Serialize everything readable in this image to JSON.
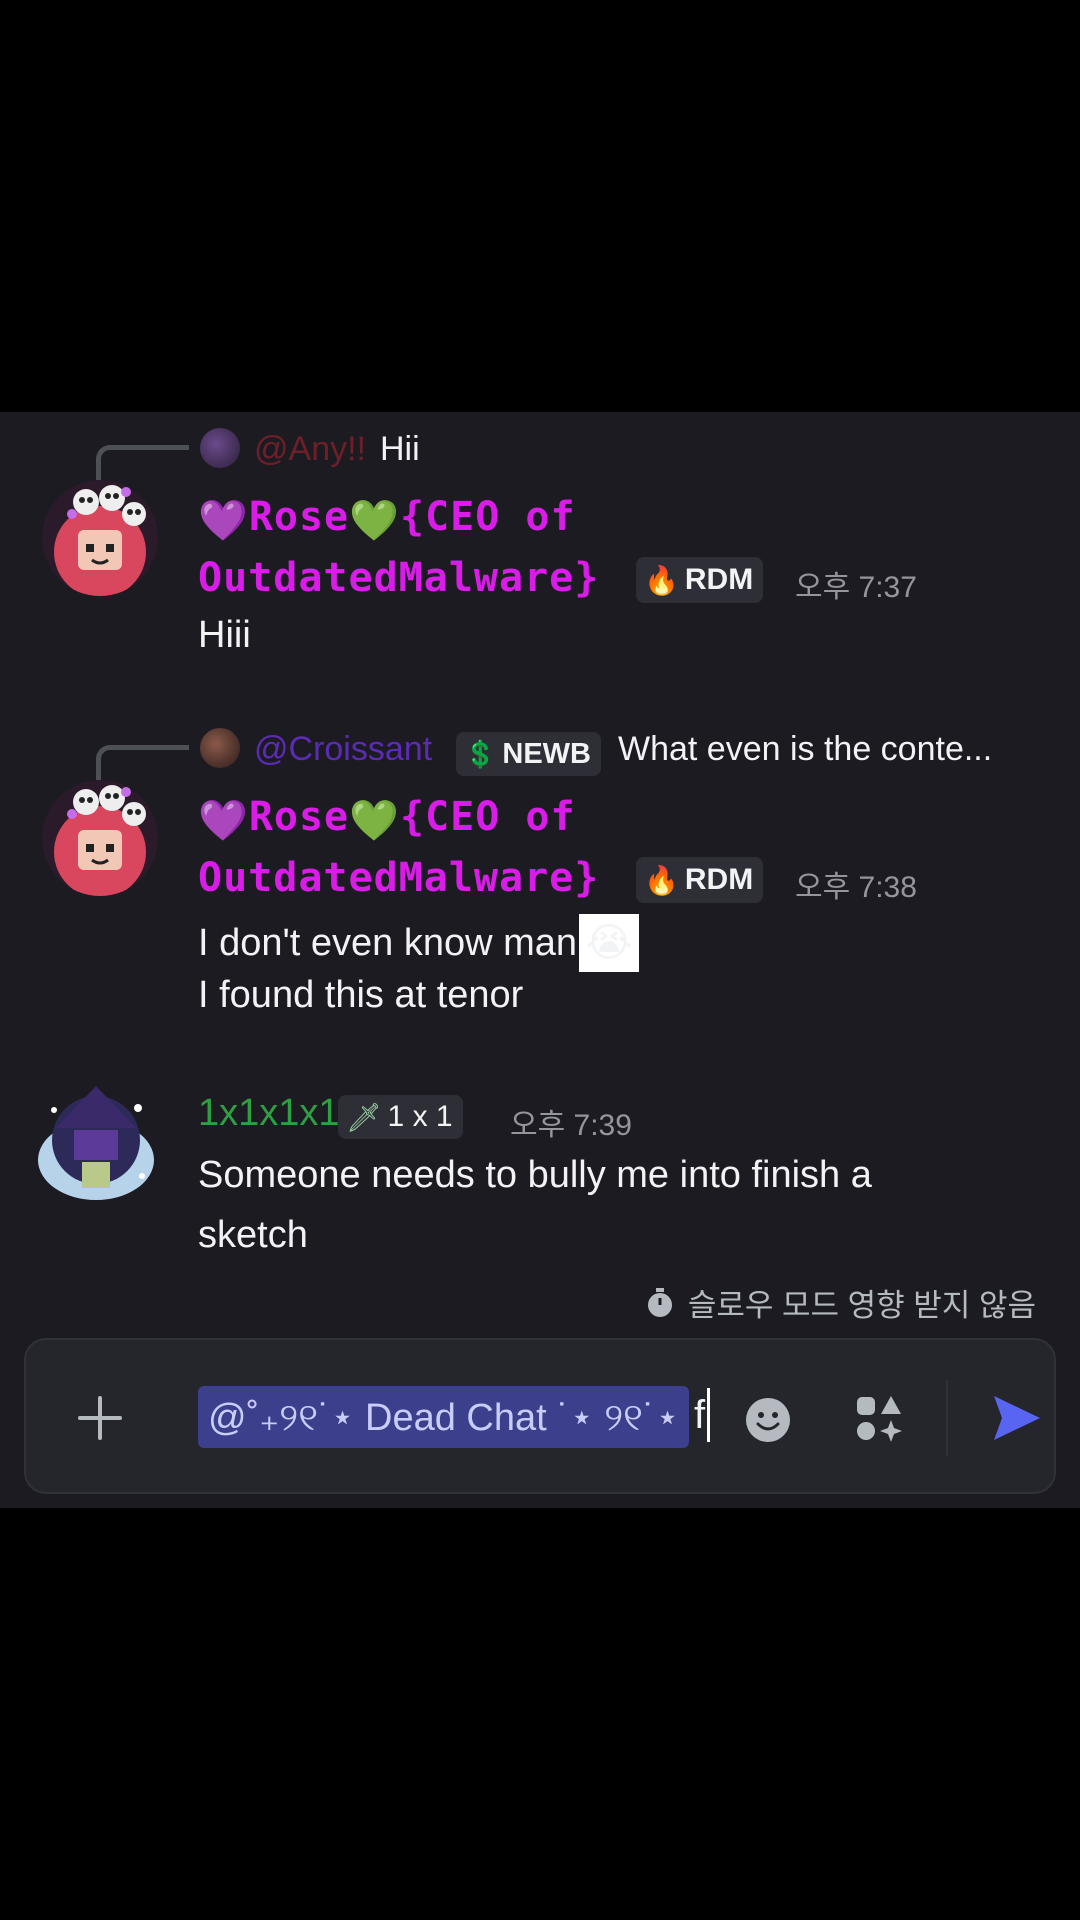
{
  "messages": [
    {
      "reply": {
        "username": "@Any!!",
        "name_color": "#6e1f27",
        "text": "Hii"
      },
      "author": {
        "name_line1_a": "Rose",
        "name_line1_b": "{CEO of",
        "name_line2": "OutdatedMalware}",
        "heart1": "💜",
        "heart2": "💚",
        "name_color": "#d91ce8"
      },
      "tag": {
        "icon": "🔥",
        "label": "RDM"
      },
      "time": "오후 7:37",
      "lines": [
        "Hiii"
      ]
    },
    {
      "reply": {
        "username": "@Croissant",
        "name_color": "#5b2bb5",
        "tag_icon": "💲",
        "tag_label": "NEWB",
        "text": "What even is the conte..."
      },
      "author": {
        "name_line1_a": "Rose",
        "name_line1_b": "{CEO of",
        "name_line2": "OutdatedMalware}",
        "heart1": "💜",
        "heart2": "💚"
      },
      "tag": {
        "icon": "🔥",
        "label": "RDM"
      },
      "time": "오후 7:38",
      "lines": [
        "I don't even know man",
        "I found this at tenor"
      ],
      "emoji": "😭"
    },
    {
      "author": {
        "name": "1x1x1x1",
        "name_color": "#2ea043"
      },
      "tag": {
        "icon": "🗡",
        "label": "1 x 1"
      },
      "time": "오후 7:39",
      "lines": [
        "Someone needs to bully me into finish a",
        "sketch"
      ]
    }
  ],
  "slowmode": {
    "icon": "stopwatch-icon",
    "text": "슬로우 모드 영향 받지 않음"
  },
  "composer": {
    "add_icon": "plus-icon",
    "mention": "@˚₊୨୧˙⋆ Dead Chat ˙⋆ ୨୧˙⋆",
    "typed": "f",
    "emoji_icon": "smile-icon",
    "apps_icon": "apps-icon",
    "send_icon": "send-icon",
    "accent": "#5865f2"
  }
}
